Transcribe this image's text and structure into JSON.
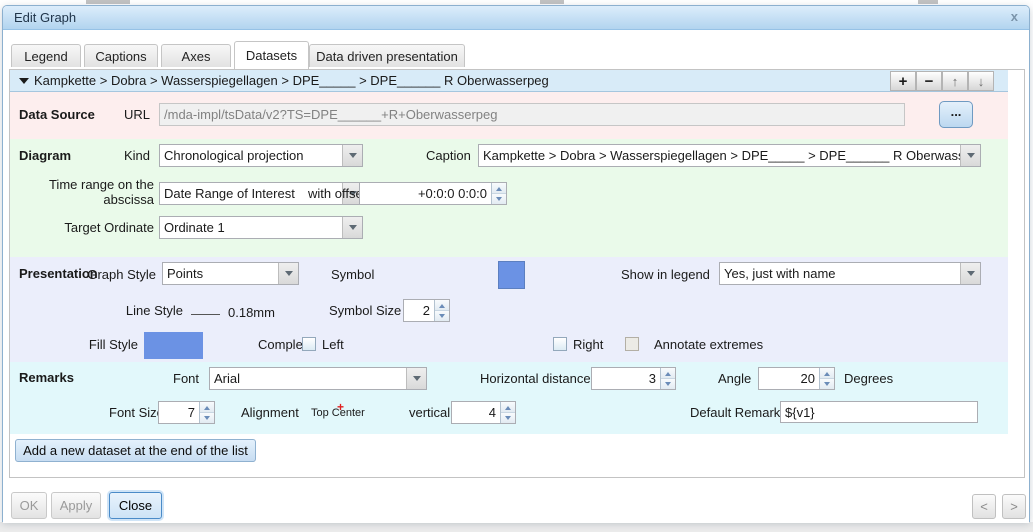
{
  "dialog": {
    "title": "Edit Graph",
    "close_glyph": "x"
  },
  "tabs": [
    {
      "label": "Legend"
    },
    {
      "label": "Captions"
    },
    {
      "label": "Axes"
    },
    {
      "label": "Datasets"
    },
    {
      "label": "Data driven presentation"
    }
  ],
  "dataset_header": {
    "breadcrumb": "Kampkette > Dobra > Wasserspiegellagen > DPE_____ > DPE______ R Oberwasserpeg",
    "add_label": "+",
    "remove_label": "−",
    "move_up_label": "↑",
    "move_down_label": "↓"
  },
  "data_source": {
    "label": "Data Source",
    "url_label": "URL",
    "url_value": "/mda-impl/tsData/v2?TS=DPE______+R+Oberwasserpeg",
    "browse_label": "..."
  },
  "diagram": {
    "label": "Diagram",
    "kind_label": "Kind",
    "kind_value": "Chronological projection",
    "caption_label": "Caption",
    "caption_value": "Kampkette > Dobra > Wasserspiegellagen > DPE_____ > DPE______ R Oberwasserpeg",
    "time_range_label_line1": "Time range on the",
    "time_range_label_line2": "abscissa",
    "time_range_value": "Date Range of Interest",
    "offset_label": "with offset",
    "offset_value": "+0:0:0 0:0:0",
    "target_ordinate_label": "Target Ordinate",
    "target_ordinate_value": "Ordinate 1"
  },
  "presentation": {
    "label": "Presentation",
    "graph_style_label": "Graph Style",
    "graph_style_value": "Points",
    "symbol_label": "Symbol",
    "show_in_legend_label": "Show in legend",
    "show_in_legend_value": "Yes, just with name",
    "line_style_label": "Line Style",
    "line_style_value": "0.18mm",
    "symbol_size_label": "Symbol Size",
    "symbol_size_value": "2",
    "fill_style_label": "Fill Style",
    "complete_label": "Complete",
    "left_label": "Left",
    "right_label": "Right",
    "annotate_label": "Annotate extremes"
  },
  "remarks": {
    "label": "Remarks",
    "font_label": "Font",
    "font_value": "Arial",
    "horizontal_label": "Horizontal distance",
    "horizontal_value": "3",
    "angle_label": "Angle",
    "angle_value": "20",
    "degrees_label": "Degrees",
    "font_size_label": "Font Size",
    "font_size_value": "7",
    "alignment_label": "Alignment",
    "alignment_value": "Top Center",
    "vertical_label": "vertical",
    "vertical_value": "4",
    "default_remark_label": "Default Remark",
    "default_remark_value": "${v1}"
  },
  "add_dataset_button": "Add a new dataset at the end of the list",
  "footer": {
    "ok_label": "OK",
    "apply_label": "Apply",
    "close_label": "Close",
    "prev_label": "<",
    "next_label": ">"
  },
  "colors": {
    "symbol_swatch": "#6b92e4",
    "fill_swatch": "#6b92e4"
  }
}
